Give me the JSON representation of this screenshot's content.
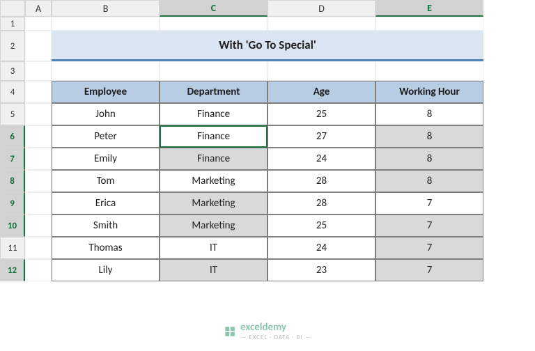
{
  "columns": [
    "A",
    "B",
    "C",
    "D",
    "E"
  ],
  "rows": [
    "1",
    "2",
    "3",
    "4",
    "5",
    "6",
    "7",
    "8",
    "9",
    "10",
    "11",
    "12"
  ],
  "selected_columns": [
    "C",
    "E"
  ],
  "selected_rows": [
    "6",
    "7",
    "8",
    "9",
    "10",
    "12"
  ],
  "title": "With 'Go To Special'",
  "headers": [
    "Employee",
    "Department",
    "Age",
    "Working Hour"
  ],
  "data": [
    {
      "emp": "John",
      "dept": "Finance",
      "age": "25",
      "wh": "8",
      "dept_gray": false,
      "wh_gray": false
    },
    {
      "emp": "Peter",
      "dept": "Finance",
      "age": "27",
      "wh": "8",
      "dept_gray": false,
      "wh_gray": true
    },
    {
      "emp": "Emily",
      "dept": "Finance",
      "age": "24",
      "wh": "8",
      "dept_gray": true,
      "wh_gray": true
    },
    {
      "emp": "Tom",
      "dept": "Marketing",
      "age": "28",
      "wh": "8",
      "dept_gray": false,
      "wh_gray": true
    },
    {
      "emp": "Erica",
      "dept": "Marketing",
      "age": "28",
      "wh": "7",
      "dept_gray": true,
      "wh_gray": false
    },
    {
      "emp": "Smith",
      "dept": "Marketing",
      "age": "25",
      "wh": "7",
      "dept_gray": true,
      "wh_gray": true
    },
    {
      "emp": "Thomas",
      "dept": "IT",
      "age": "24",
      "wh": "7",
      "dept_gray": false,
      "wh_gray": true
    },
    {
      "emp": "Lily",
      "dept": "IT",
      "age": "23",
      "wh": "7",
      "dept_gray": true,
      "wh_gray": true
    }
  ],
  "active_cell": "C6",
  "watermark": {
    "name": "exceldemy",
    "tag": "— EXCEL · DATA · BI —"
  },
  "chart_data": {
    "type": "table",
    "title": "With 'Go To Special'",
    "columns": [
      "Employee",
      "Department",
      "Age",
      "Working Hour"
    ],
    "rows": [
      [
        "John",
        "Finance",
        25,
        8
      ],
      [
        "Peter",
        "Finance",
        27,
        8
      ],
      [
        "Emily",
        "Finance",
        24,
        8
      ],
      [
        "Tom",
        "Marketing",
        28,
        8
      ],
      [
        "Erica",
        "Marketing",
        28,
        7
      ],
      [
        "Smith",
        "Marketing",
        25,
        7
      ],
      [
        "Thomas",
        "IT",
        24,
        7
      ],
      [
        "Lily",
        "IT",
        23,
        7
      ]
    ]
  }
}
